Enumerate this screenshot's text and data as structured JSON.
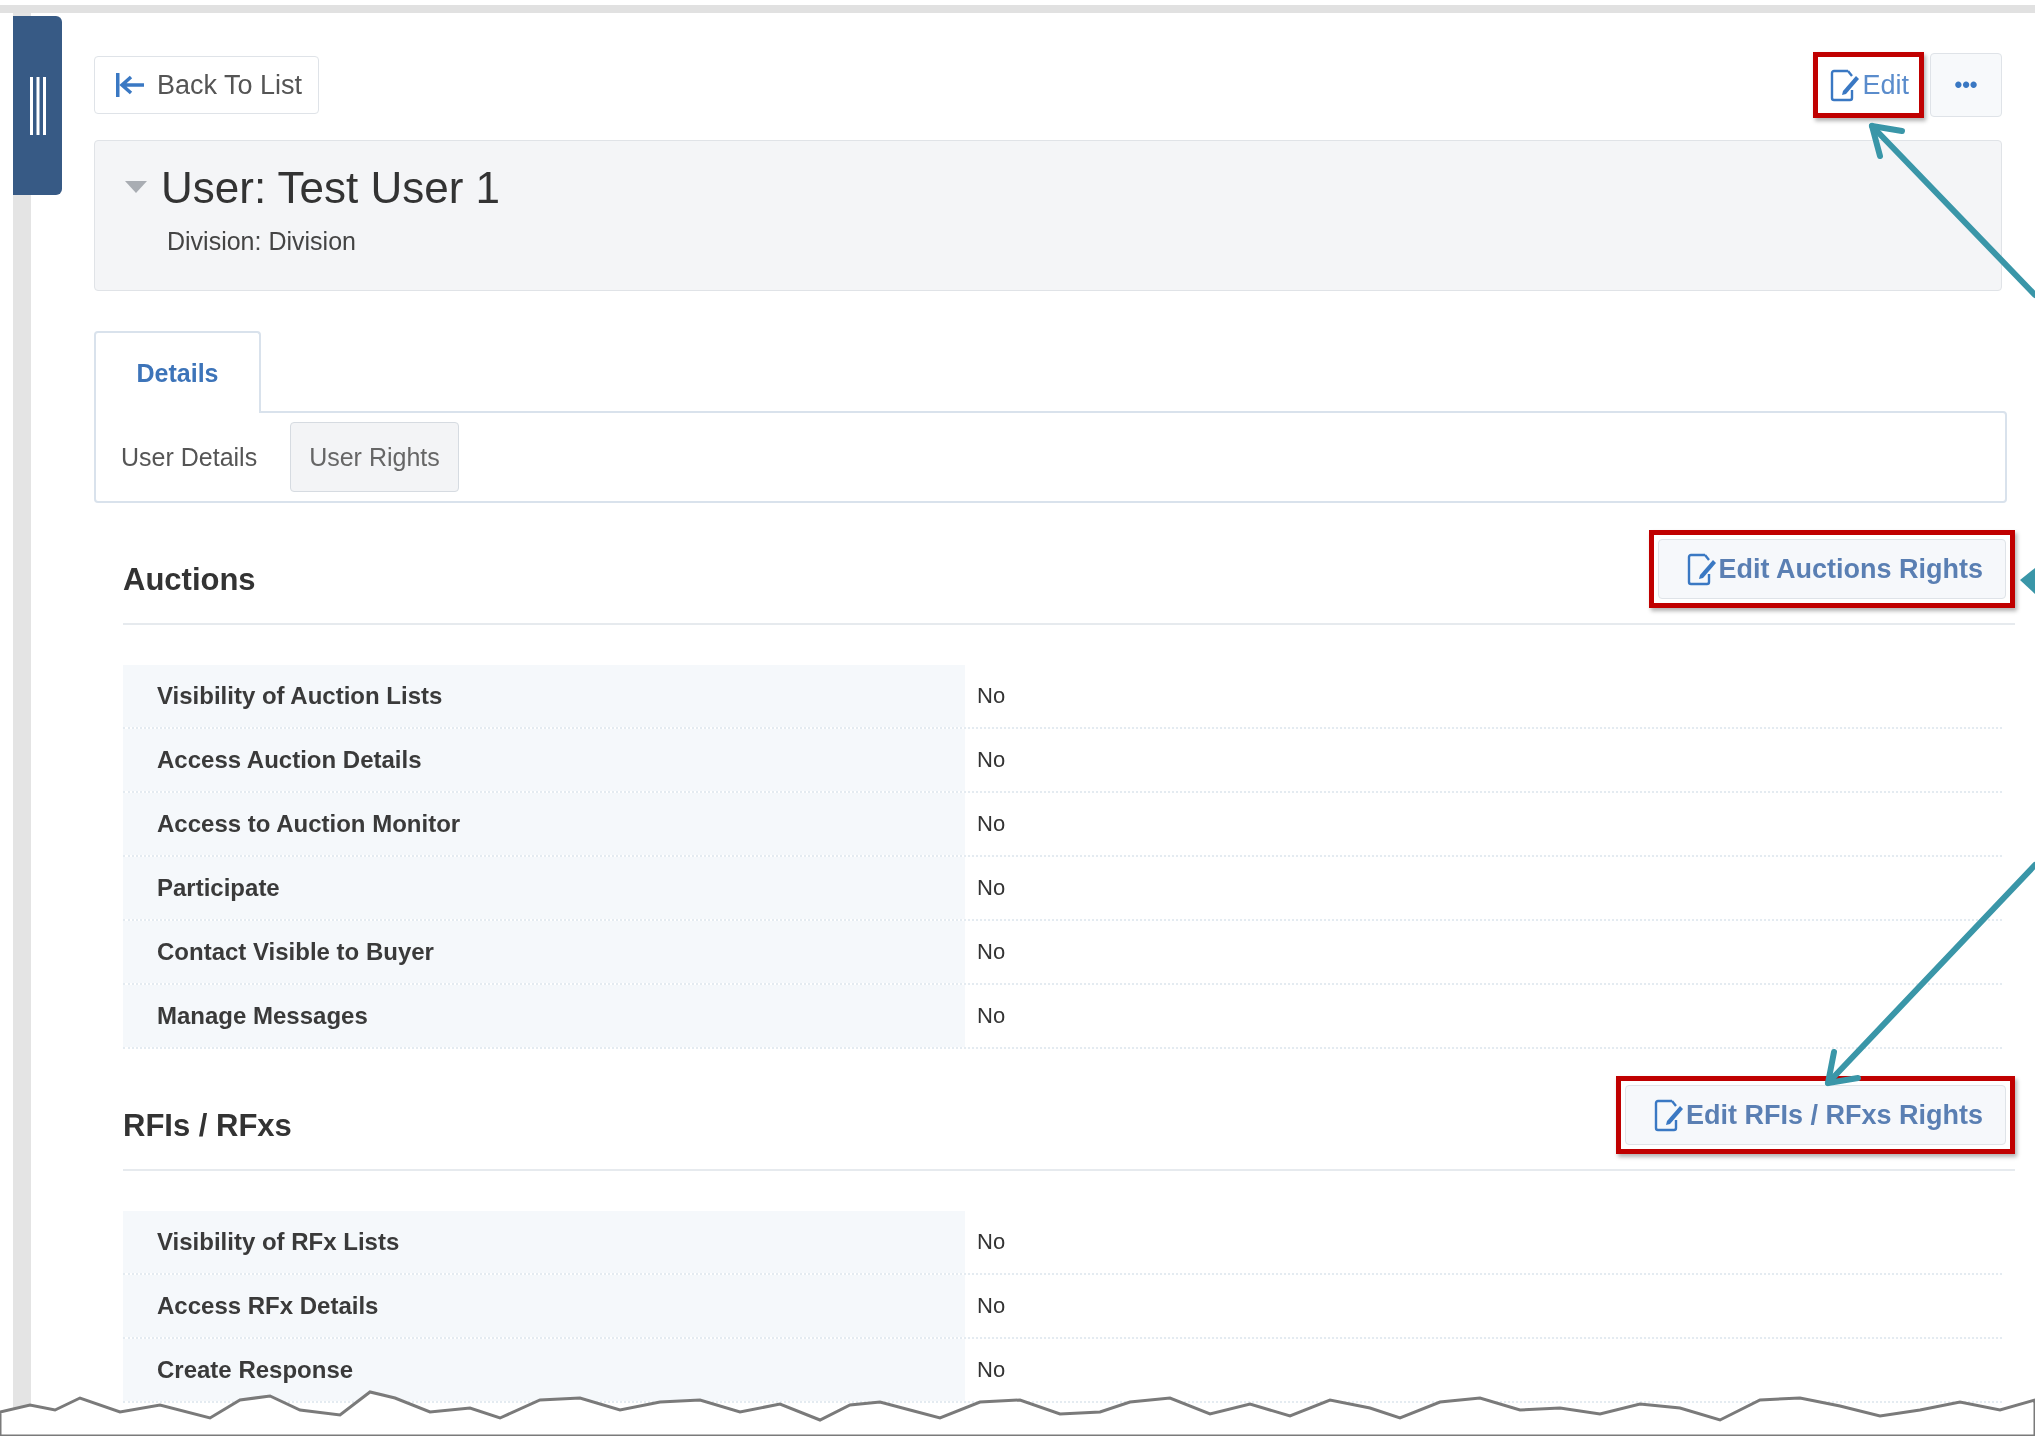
{
  "back_button": {
    "label": "Back To List"
  },
  "edit_button": {
    "label": "Edit",
    "highlighted": true
  },
  "more_button": {
    "label": "•••"
  },
  "header": {
    "title": "User: Test User 1",
    "subtitle": "Division: Division",
    "expanded": true
  },
  "tabs": [
    {
      "label": "Details",
      "selected": true
    }
  ],
  "subtabs": [
    {
      "label": "User Details",
      "selected": false
    },
    {
      "label": "User Rights",
      "selected": true
    }
  ],
  "sections": [
    {
      "title": "Auctions",
      "edit_button": {
        "label": "Edit Auctions Rights",
        "highlighted": true
      },
      "rows": [
        {
          "label": "Visibility of Auction Lists",
          "value": "No"
        },
        {
          "label": "Access Auction Details",
          "value": "No"
        },
        {
          "label": "Access to Auction Monitor",
          "value": "No"
        },
        {
          "label": "Participate",
          "value": "No"
        },
        {
          "label": "Contact Visible to Buyer",
          "value": "No"
        },
        {
          "label": "Manage Messages",
          "value": "No"
        }
      ]
    },
    {
      "title": "RFIs / RFxs",
      "edit_button": {
        "label": "Edit RFIs / RFxs Rights",
        "highlighted": true
      },
      "rows": [
        {
          "label": "Visibility of RFx Lists",
          "value": "No"
        },
        {
          "label": "Access RFx Details",
          "value": "No"
        },
        {
          "label": "Create Response",
          "value": "No"
        }
      ]
    }
  ]
}
